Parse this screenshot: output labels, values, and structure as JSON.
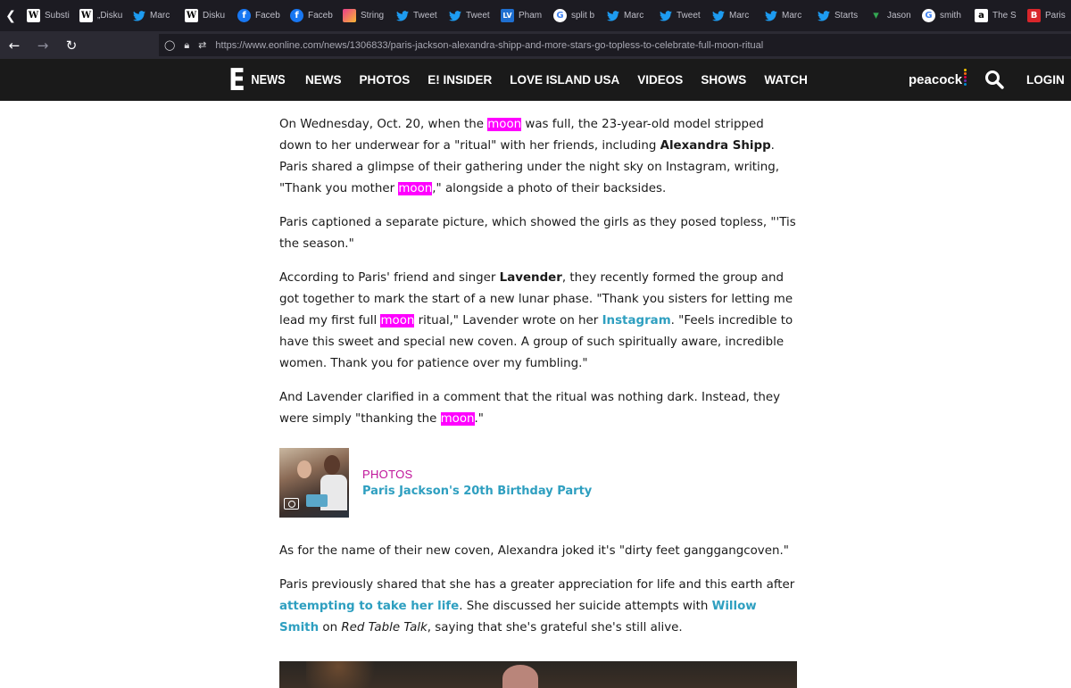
{
  "tabs": [
    {
      "icon": "wikipedia-icon",
      "glyph": "W",
      "label": "Substi"
    },
    {
      "icon": "wikipedia-icon",
      "glyph": "W",
      "label": "„Disku"
    },
    {
      "icon": "twitter-icon",
      "glyph": "",
      "label": "Marc"
    },
    {
      "icon": "wikipedia-icon",
      "glyph": "W",
      "label": "Disku"
    },
    {
      "icon": "facebook-icon",
      "glyph": "f",
      "label": "Faceb"
    },
    {
      "icon": "facebook-icon",
      "glyph": "f",
      "label": "Faceb"
    },
    {
      "icon": "strings-icon",
      "glyph": "",
      "label": "String"
    },
    {
      "icon": "twitter-icon",
      "glyph": "",
      "label": "Tweet"
    },
    {
      "icon": "twitter-icon",
      "glyph": "",
      "label": "Tweet"
    },
    {
      "icon": "lv-icon",
      "glyph": "LV",
      "label": "Pham"
    },
    {
      "icon": "google-icon",
      "glyph": "G",
      "label": "split b"
    },
    {
      "icon": "twitter-icon",
      "glyph": "",
      "label": "Marc"
    },
    {
      "icon": "twitter-icon",
      "glyph": "",
      "label": "Tweet"
    },
    {
      "icon": "twitter-icon",
      "glyph": "",
      "label": "Marc"
    },
    {
      "icon": "twitter-icon",
      "glyph": "",
      "label": "Marc"
    },
    {
      "icon": "twitter-icon",
      "glyph": "",
      "label": "Starts"
    },
    {
      "icon": "maps-pin-icon",
      "glyph": "",
      "label": "Jason"
    },
    {
      "icon": "google-icon",
      "glyph": "G",
      "label": "smith"
    },
    {
      "icon": "amazon-icon",
      "glyph": "a",
      "label": "The S"
    },
    {
      "icon": "bi-icon",
      "glyph": "B",
      "label": "Paris"
    }
  ],
  "url": "https://www.eonline.com/news/1306833/paris-jackson-alexandra-shipp-and-more-stars-go-topless-to-celebrate-full-moon-ritual",
  "site": {
    "logo_e": "E",
    "logo_news": "NEWS",
    "nav": [
      "NEWS",
      "PHOTOS",
      "E! INSIDER",
      "LOVE ISLAND USA",
      "VIDEOS",
      "SHOWS",
      "WATCH"
    ],
    "peacock": "peacock",
    "login": "LOGIN"
  },
  "colors": {
    "highlight": "#ff00ff",
    "link": "#2e9fc0",
    "kicker": "#c0139a",
    "header_bg": "#1a1a1a"
  },
  "article": {
    "p1": [
      {
        "t": "On Wednesday, Oct. 20, when the "
      },
      {
        "t": "moon",
        "s": "hl"
      },
      {
        "t": " was full, the 23-year-old model stripped down to her underwear for a \"ritual\" with her friends, including "
      },
      {
        "t": "Alexandra Shipp",
        "s": "b"
      },
      {
        "t": ". Paris shared a glimpse of their gathering under the night sky on Instagram, writing, \"Thank you mother "
      },
      {
        "t": "moon",
        "s": "hl"
      },
      {
        "t": ",\" alongside a photo of their backsides."
      }
    ],
    "p2": [
      {
        "t": "Paris captioned a separate picture, which showed the girls as they posed topless, \"'Tis the season.\""
      }
    ],
    "p3": [
      {
        "t": "According to Paris' friend and singer "
      },
      {
        "t": "Lavender",
        "s": "b"
      },
      {
        "t": ", they recently formed the group and got together to mark the start of a new lunar phase. \"Thank you sisters for letting me lead my first full "
      },
      {
        "t": "moon",
        "s": "hl"
      },
      {
        "t": " ritual,\" Lavender wrote on her "
      },
      {
        "t": "Instagram",
        "s": "lnk"
      },
      {
        "t": ". \"Feels incredible to have this sweet and special new coven. A group of such spiritually aware, incredible women. Thank you for patience over my fumbling.\""
      }
    ],
    "p4": [
      {
        "t": "And Lavender clarified in a comment that the ritual was nothing dark. Instead, they were simply \"thanking the "
      },
      {
        "t": "moon",
        "s": "hl"
      },
      {
        "t": ".\""
      }
    ],
    "related": {
      "kicker": "PHOTOS",
      "title": "Paris Jackson's 20th Birthday Party"
    },
    "p5": [
      {
        "t": "As for the name of their new coven, Alexandra joked it's \"dirty feet ganggangcoven.\""
      }
    ],
    "p6": [
      {
        "t": "Paris previously shared that she has a greater appreciation for life and this earth after "
      },
      {
        "t": "attempting to take her life",
        "s": "lnk"
      },
      {
        "t": ". She discussed her suicide attempts with "
      },
      {
        "t": "Willow Smith",
        "s": "lnk"
      },
      {
        "t": " on "
      },
      {
        "t": "Red Table Talk",
        "s": "it"
      },
      {
        "t": ", saying that she's grateful she's still alive."
      }
    ]
  }
}
